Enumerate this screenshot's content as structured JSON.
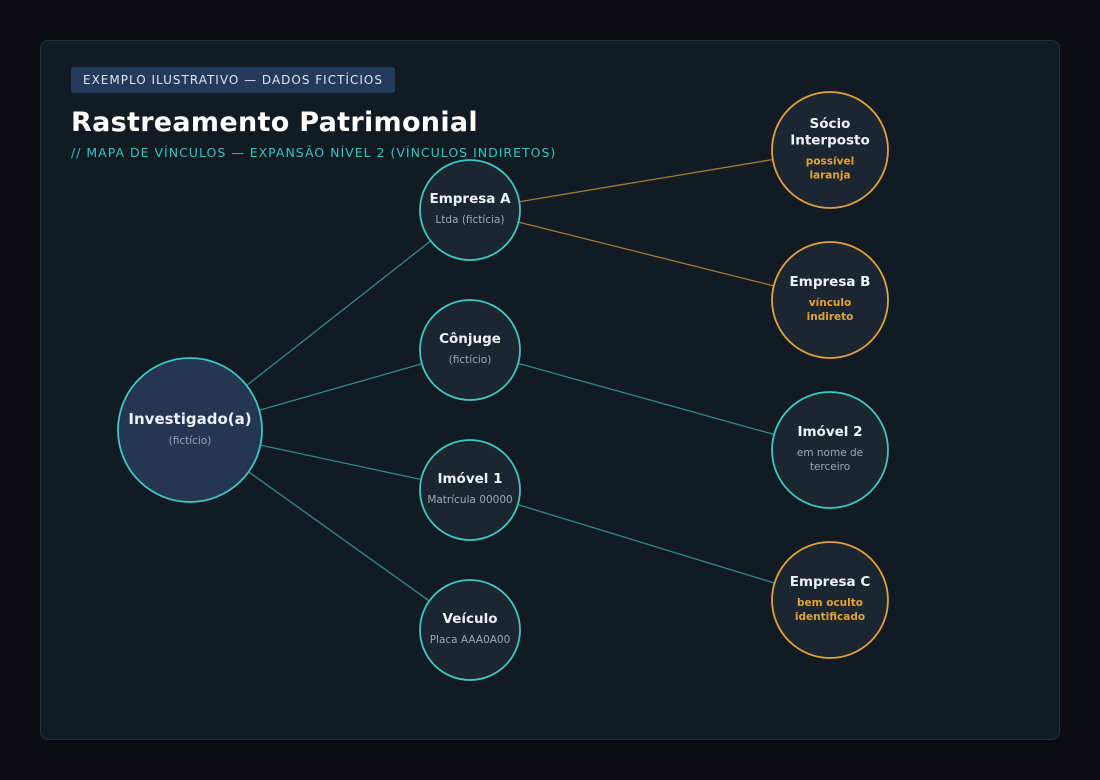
{
  "header": {
    "badge": "EXEMPLO ILUSTRATIVO — DADOS FICTÍCIOS",
    "title": "Rastreamento Patrimonial",
    "subtitle": "// MAPA DE VÍNCULOS — EXPANSÃO NÍVEL 2 (VÍNCULOS INDIRETOS)"
  },
  "colors": {
    "teal": "#3cc9c2",
    "gold": "#e3a23a",
    "node_fill": "#1c2631",
    "center_fill": "#243652",
    "teal_line": "#2f8a86",
    "gold_line": "#a67b34",
    "title_text": "#eef2f6",
    "sub_text": "#9aa8b6"
  },
  "nodes": [
    {
      "id": "investigado",
      "kind": "center",
      "title": [
        "Investigado(a)"
      ],
      "sub": [
        "(fictício)"
      ]
    },
    {
      "id": "empresa-a",
      "kind": "level1",
      "title": [
        "Empresa A"
      ],
      "sub": [
        "Ltda (fictícia)"
      ]
    },
    {
      "id": "conjuge",
      "kind": "level1",
      "title": [
        "Cônjuge"
      ],
      "sub": [
        "(fictício)"
      ]
    },
    {
      "id": "imovel-1",
      "kind": "level1",
      "title": [
        "Imóvel 1"
      ],
      "sub": [
        "Matrícula 00000"
      ]
    },
    {
      "id": "veiculo",
      "kind": "level1",
      "title": [
        "Veículo"
      ],
      "sub": [
        "Placa AAA0A00"
      ]
    },
    {
      "id": "socio-interposto",
      "kind": "alert",
      "title": [
        "Sócio",
        "Interposto"
      ],
      "sub": [
        "possível",
        "laranja"
      ]
    },
    {
      "id": "empresa-b",
      "kind": "alert",
      "title": [
        "Empresa B"
      ],
      "sub": [
        "vínculo",
        "indireto"
      ]
    },
    {
      "id": "imovel-2",
      "kind": "level2",
      "title": [
        "Imóvel 2"
      ],
      "sub": [
        "em nome de",
        "terceiro"
      ]
    },
    {
      "id": "empresa-c",
      "kind": "alert",
      "title": [
        "Empresa C"
      ],
      "sub": [
        "bem oculto",
        "identificado"
      ]
    }
  ],
  "edges": [
    {
      "from": "investigado",
      "to": "empresa-a",
      "kind": "teal"
    },
    {
      "from": "investigado",
      "to": "conjuge",
      "kind": "teal"
    },
    {
      "from": "investigado",
      "to": "imovel-1",
      "kind": "teal"
    },
    {
      "from": "investigado",
      "to": "veiculo",
      "kind": "teal"
    },
    {
      "from": "empresa-a",
      "to": "socio-interposto",
      "kind": "gold"
    },
    {
      "from": "empresa-a",
      "to": "empresa-b",
      "kind": "gold"
    },
    {
      "from": "conjuge",
      "to": "imovel-2",
      "kind": "teal"
    },
    {
      "from": "imovel-1",
      "to": "empresa-c",
      "kind": "teal"
    }
  ]
}
